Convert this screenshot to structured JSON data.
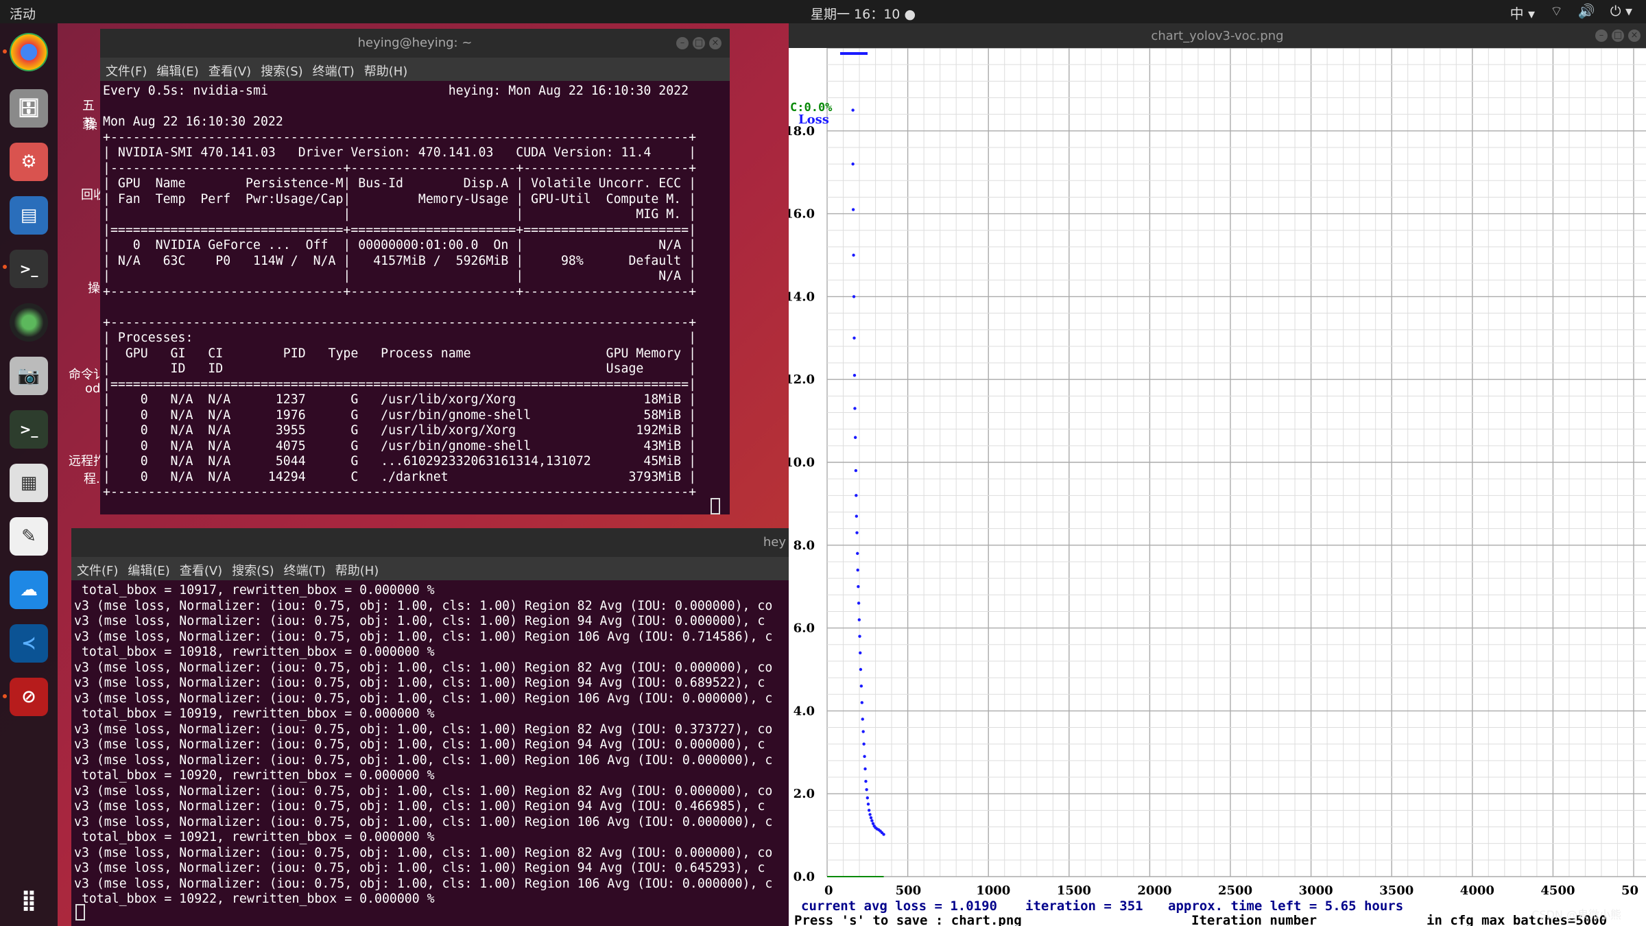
{
  "topbar": {
    "activities": "活动",
    "clock": "星期一 16：10",
    "input_method": "中"
  },
  "dock": {
    "icons": [
      "chrome-icon",
      "files-icon",
      "settings-icon",
      "writer-icon",
      "terminal-icon",
      "webcam-icon",
      "camera-icon",
      "terminal2-icon",
      "calculator-icon",
      "text-editor-icon",
      "remote-icon",
      "vscode-icon",
      "blocked-icon",
      "apps-grid-icon"
    ]
  },
  "desktop": {
    "labels": [
      "五菱",
      "操",
      "回收",
      "操",
      "命令讠",
      "od",
      "远程拃",
      "程.l"
    ]
  },
  "term1": {
    "title": "heying@heying: ~",
    "menu": [
      "文件(F)",
      "编辑(E)",
      "查看(V)",
      "搜索(S)",
      "终端(T)",
      "帮助(H)"
    ],
    "lines": [
      "Every 0.5s: nvidia-smi                        heying: Mon Aug 22 16:10:30 2022",
      "",
      "Mon Aug 22 16:10:30 2022",
      "+-----------------------------------------------------------------------------+",
      "| NVIDIA-SMI 470.141.03   Driver Version: 470.141.03   CUDA Version: 11.4     |",
      "|-------------------------------+----------------------+----------------------+",
      "| GPU  Name        Persistence-M| Bus-Id        Disp.A | Volatile Uncorr. ECC |",
      "| Fan  Temp  Perf  Pwr:Usage/Cap|         Memory-Usage | GPU-Util  Compute M. |",
      "|                               |                      |               MIG M. |",
      "|===============================+======================+======================|",
      "|   0  NVIDIA GeForce ...  Off  | 00000000:01:00.0  On |                  N/A |",
      "| N/A   63C    P0   114W /  N/A |   4157MiB /  5926MiB |     98%      Default |",
      "|                               |                      |                  N/A |",
      "+-------------------------------+----------------------+----------------------+",
      "",
      "+-----------------------------------------------------------------------------+",
      "| Processes:                                                                  |",
      "|  GPU   GI   CI        PID   Type   Process name                  GPU Memory |",
      "|        ID   ID                                                   Usage      |",
      "|=============================================================================|",
      "|    0   N/A  N/A      1237      G   /usr/lib/xorg/Xorg                 18MiB |",
      "|    0   N/A  N/A      1976      G   /usr/bin/gnome-shell               58MiB |",
      "|    0   N/A  N/A      3955      G   /usr/lib/xorg/Xorg                192MiB |",
      "|    0   N/A  N/A      4075      G   /usr/bin/gnome-shell               43MiB |",
      "|    0   N/A  N/A      5044      G   ...610292332063161314,131072       45MiB |",
      "|    0   N/A  N/A     14294      C   ./darknet                        3793MiB |",
      "+-----------------------------------------------------------------------------+"
    ]
  },
  "term2": {
    "title": "hey",
    "menu": [
      "文件(F)",
      "编辑(E)",
      "查看(V)",
      "搜索(S)",
      "终端(T)",
      "帮助(H)"
    ],
    "lines": [
      " total_bbox = 10917, rewritten_bbox = 0.000000 %",
      "v3 (mse loss, Normalizer: (iou: 0.75, obj: 1.00, cls: 1.00) Region 82 Avg (IOU: 0.000000), co",
      "v3 (mse loss, Normalizer: (iou: 0.75, obj: 1.00, cls: 1.00) Region 94 Avg (IOU: 0.000000), c",
      "v3 (mse loss, Normalizer: (iou: 0.75, obj: 1.00, cls: 1.00) Region 106 Avg (IOU: 0.714586), c",
      " total_bbox = 10918, rewritten_bbox = 0.000000 %",
      "v3 (mse loss, Normalizer: (iou: 0.75, obj: 1.00, cls: 1.00) Region 82 Avg (IOU: 0.000000), co",
      "v3 (mse loss, Normalizer: (iou: 0.75, obj: 1.00, cls: 1.00) Region 94 Avg (IOU: 0.689522), c",
      "v3 (mse loss, Normalizer: (iou: 0.75, obj: 1.00, cls: 1.00) Region 106 Avg (IOU: 0.000000), c",
      " total_bbox = 10919, rewritten_bbox = 0.000000 %",
      "v3 (mse loss, Normalizer: (iou: 0.75, obj: 1.00, cls: 1.00) Region 82 Avg (IOU: 0.373727), co",
      "v3 (mse loss, Normalizer: (iou: 0.75, obj: 1.00, cls: 1.00) Region 94 Avg (IOU: 0.000000), c",
      "v3 (mse loss, Normalizer: (iou: 0.75, obj: 1.00, cls: 1.00) Region 106 Avg (IOU: 0.000000), c",
      " total_bbox = 10920, rewritten_bbox = 0.000000 %",
      "v3 (mse loss, Normalizer: (iou: 0.75, obj: 1.00, cls: 1.00) Region 82 Avg (IOU: 0.000000), co",
      "v3 (mse loss, Normalizer: (iou: 0.75, obj: 1.00, cls: 1.00) Region 94 Avg (IOU: 0.466985), c",
      "v3 (mse loss, Normalizer: (iou: 0.75, obj: 1.00, cls: 1.00) Region 106 Avg (IOU: 0.000000), c",
      " total_bbox = 10921, rewritten_bbox = 0.000000 %",
      "v3 (mse loss, Normalizer: (iou: 0.75, obj: 1.00, cls: 1.00) Region 82 Avg (IOU: 0.000000), co",
      "v3 (mse loss, Normalizer: (iou: 0.75, obj: 1.00, cls: 1.00) Region 94 Avg (IOU: 0.645293), c",
      "v3 (mse loss, Normalizer: (iou: 0.75, obj: 1.00, cls: 1.00) Region 106 Avg (IOU: 0.000000), c",
      " total_bbox = 10922, rewritten_bbox = 0.000000 %"
    ]
  },
  "viewer": {
    "title": "chart_yolov3-voc.png"
  },
  "chart_data": {
    "type": "scatter",
    "legend": [
      "C:0.0%",
      "Loss"
    ],
    "xlabel": "Iteration number",
    "xlim": [
      0,
      5000
    ],
    "ylim": [
      0,
      20
    ],
    "x_ticks": [
      "0",
      "500",
      "1000",
      "1500",
      "2000",
      "2500",
      "3000",
      "3500",
      "4000",
      "4500",
      "50"
    ],
    "y_ticks": [
      "0.0",
      "2.0",
      "4.0",
      "6.0",
      "8.0",
      "10.0",
      "12.0",
      "14.0",
      "16.0",
      "18.0"
    ],
    "status": {
      "avg_loss": "current avg loss = 1.0190",
      "iteration": "iteration = 351",
      "time_left": "approx. time left = 5.65 hours",
      "save_hint": "Press 's' to save : chart.png",
      "max_batches": "in cfg max_batches=5000"
    },
    "series": [
      {
        "name": "Loss",
        "x": [
          160,
          160,
          162,
          164,
          166,
          168,
          170,
          172,
          175,
          178,
          180,
          182,
          185,
          188,
          190,
          193,
          196,
          199,
          202,
          205,
          208,
          212,
          216,
          220,
          224,
          228,
          232,
          236,
          240,
          245,
          250,
          255,
          260,
          266,
          272,
          278,
          285,
          292,
          300,
          310,
          320,
          330,
          340,
          351
        ],
        "y": [
          18.5,
          17.2,
          16.1,
          15.0,
          14.0,
          13.0,
          12.1,
          11.3,
          10.6,
          9.8,
          9.2,
          8.7,
          8.3,
          7.8,
          7.4,
          7.0,
          6.6,
          6.2,
          5.8,
          5.4,
          5.0,
          4.6,
          4.2,
          3.8,
          3.5,
          3.2,
          2.9,
          2.6,
          2.3,
          2.1,
          1.9,
          1.75,
          1.6,
          1.5,
          1.42,
          1.35,
          1.28,
          1.22,
          1.18,
          1.15,
          1.13,
          1.1,
          1.06,
          1.019
        ]
      }
    ]
  },
  "watermark": "CSDN @卑微小熊"
}
